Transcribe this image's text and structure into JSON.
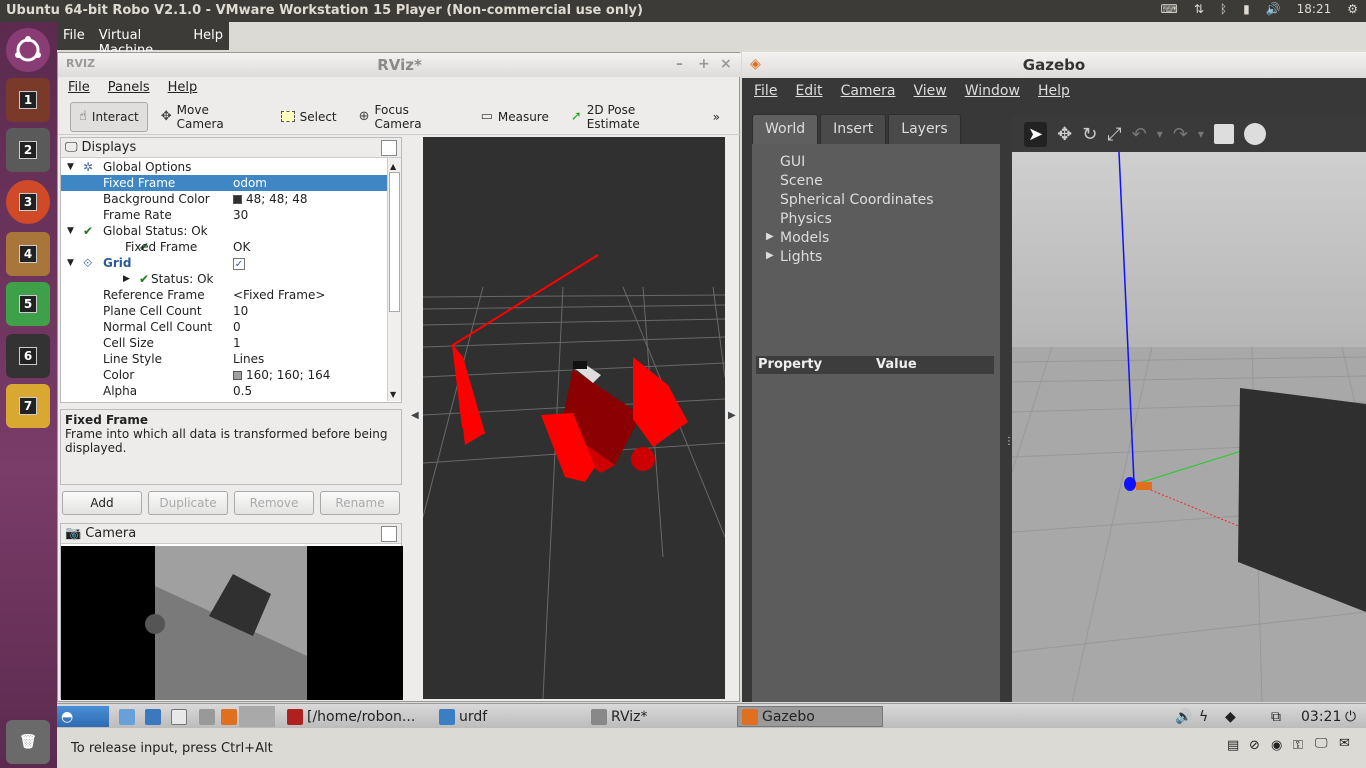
{
  "top_bar": {
    "title": "Ubuntu 64-bit Robo V2.1.0 - VMware Workstation 15 Player (Non-commercial use only)",
    "clock": "18:21"
  },
  "launcher": {
    "items": [
      "1",
      "2",
      "3",
      "4",
      "5",
      "6",
      "7"
    ]
  },
  "vm_menu": {
    "items": [
      "File",
      "Virtual Machine",
      "Help"
    ]
  },
  "rviz": {
    "title": "RViz*",
    "window_controls": [
      "–",
      "+",
      "×"
    ],
    "menu": [
      "File",
      "Panels",
      "Help"
    ],
    "toolbar": [
      {
        "icon": "interact-icon",
        "label": "Interact"
      },
      {
        "icon": "move-camera-icon",
        "label": "Move Camera"
      },
      {
        "icon": "select-icon",
        "label": "Select"
      },
      {
        "icon": "focus-camera-icon",
        "label": "Focus Camera"
      },
      {
        "icon": "measure-icon",
        "label": "Measure"
      },
      {
        "icon": "pose-estimate-icon",
        "label": "2D Pose Estimate"
      }
    ],
    "toolbar_more": "»",
    "displays_title": "Displays",
    "tree": [
      {
        "key": "Global Options",
        "value": "",
        "indent": 0,
        "expander": "▼",
        "icon": "gear"
      },
      {
        "key": "Fixed Frame",
        "value": "odom",
        "indent": 1,
        "selected": true
      },
      {
        "key": "Background Color",
        "value": "48; 48; 48",
        "indent": 1,
        "swatch": "#303030"
      },
      {
        "key": "Frame Rate",
        "value": "30",
        "indent": 1
      },
      {
        "key": "Global Status: Ok",
        "value": "",
        "indent": 0,
        "expander": "▼",
        "icon": "check"
      },
      {
        "key": "Fixed Frame",
        "value": "OK",
        "indent": 2,
        "icon": "check"
      },
      {
        "key": "Grid",
        "value": "",
        "indent": 0,
        "expander": "▼",
        "icon": "grid",
        "bold": true,
        "checkbox": true
      },
      {
        "key": "Status: Ok",
        "value": "",
        "indent": 2,
        "expander": "▶",
        "icon": "check"
      },
      {
        "key": "Reference Frame",
        "value": "<Fixed Frame>",
        "indent": 1
      },
      {
        "key": "Plane Cell Count",
        "value": "10",
        "indent": 1
      },
      {
        "key": "Normal Cell Count",
        "value": "0",
        "indent": 1
      },
      {
        "key": "Cell Size",
        "value": "1",
        "indent": 1
      },
      {
        "key": "Line Style",
        "value": "Lines",
        "indent": 1
      },
      {
        "key": "Color",
        "value": "160; 160; 164",
        "indent": 1,
        "swatch": "#a0a0a4"
      },
      {
        "key": "Alpha",
        "value": "0.5",
        "indent": 1
      }
    ],
    "description_title": "Fixed Frame",
    "description_text": "Frame into which all data is transformed before being displayed.",
    "buttons": [
      {
        "label": "Add",
        "enabled": true
      },
      {
        "label": "Duplicate",
        "enabled": false
      },
      {
        "label": "Remove",
        "enabled": false
      },
      {
        "label": "Rename",
        "enabled": false
      }
    ],
    "camera_title": "Camera"
  },
  "gazebo": {
    "title": "Gazebo",
    "menu": [
      "File",
      "Edit",
      "Camera",
      "View",
      "Window",
      "Help"
    ],
    "tabs": [
      "World",
      "Insert",
      "Layers"
    ],
    "active_tab": "World",
    "tree": [
      {
        "label": "GUI",
        "expander": ""
      },
      {
        "label": "Scene",
        "expander": ""
      },
      {
        "label": "Spherical Coordinates",
        "expander": ""
      },
      {
        "label": "Physics",
        "expander": ""
      },
      {
        "label": "Models",
        "expander": "▶"
      },
      {
        "label": "Lights",
        "expander": "▶"
      }
    ],
    "property_col": "Property",
    "value_col": "Value"
  },
  "taskbar": {
    "tasks": [
      {
        "label": "[/home/robon...",
        "icon_color": "#b02020"
      },
      {
        "label": "urdf",
        "icon_color": "#3a7fc4"
      },
      {
        "label": "RViz*",
        "icon_color": "#888"
      },
      {
        "label": "Gazebo",
        "icon_color": "#e07020"
      }
    ],
    "clock": "03:21"
  },
  "status": {
    "hint": "To release input, press Ctrl+Alt"
  }
}
